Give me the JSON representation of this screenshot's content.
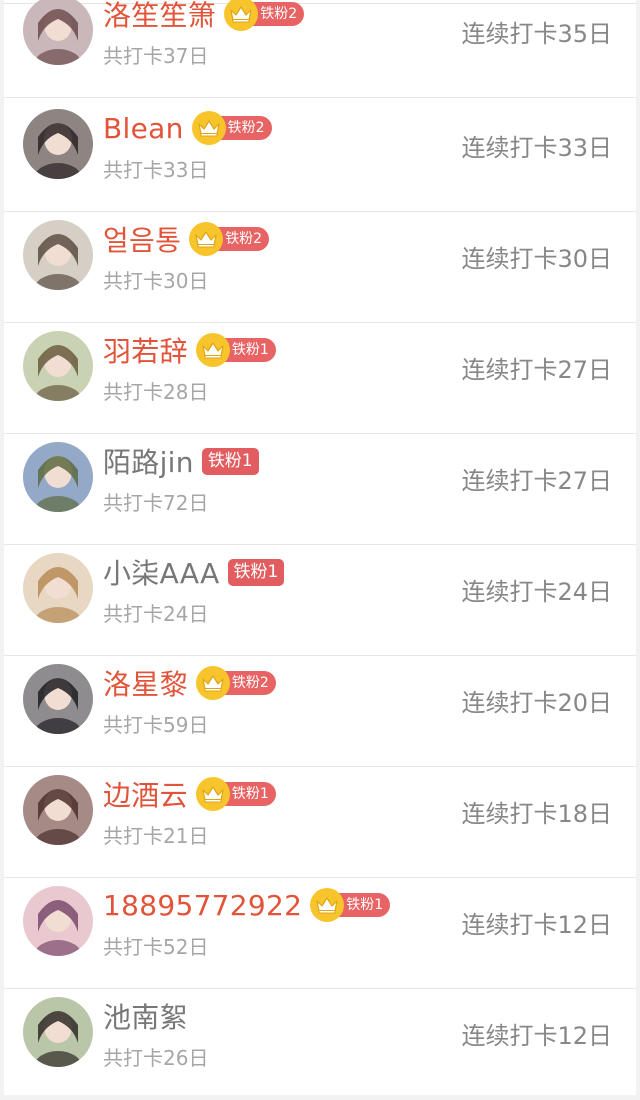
{
  "members": [
    {
      "name": "洛笙笙箫",
      "vip": true,
      "badge": "铁粉2",
      "crown": true,
      "total": "共打卡37日",
      "streak": "连续打卡35日",
      "avatar_color": "#c9b7b9",
      "avatar_accent": "#6b4a4c"
    },
    {
      "name": "Blean",
      "vip": true,
      "badge": "铁粉2",
      "crown": true,
      "total": "共打卡33日",
      "streak": "连续打卡33日",
      "avatar_color": "#8e8482",
      "avatar_accent": "#2b2424"
    },
    {
      "name": "얼음통",
      "vip": true,
      "badge": "铁粉2",
      "crown": true,
      "total": "共打卡30日",
      "streak": "连续打卡30日",
      "avatar_color": "#d6cfc5",
      "avatar_accent": "#5a4d42"
    },
    {
      "name": "羽若辞",
      "vip": true,
      "badge": "铁粉1",
      "crown": true,
      "total": "共打卡28日",
      "streak": "连续打卡27日",
      "avatar_color": "#c9d3b4",
      "avatar_accent": "#6a5a3e"
    },
    {
      "name": "陌路jin",
      "vip": false,
      "badge": "铁粉1",
      "crown": false,
      "total": "共打卡72日",
      "streak": "连续打卡27日",
      "avatar_color": "#93a9c7",
      "avatar_accent": "#5d6b3f"
    },
    {
      "name": "小柒AAA",
      "vip": false,
      "badge": "铁粉1",
      "crown": false,
      "total": "共打卡24日",
      "streak": "连续打卡24日",
      "avatar_color": "#e7d7c3",
      "avatar_accent": "#b78b55"
    },
    {
      "name": "洛星黎",
      "vip": true,
      "badge": "铁粉2",
      "crown": true,
      "total": "共打卡59日",
      "streak": "连续打卡20日",
      "avatar_color": "#8f8c8f",
      "avatar_accent": "#1f1d22"
    },
    {
      "name": "边酒云",
      "vip": true,
      "badge": "铁粉1",
      "crown": true,
      "total": "共打卡21日",
      "streak": "连续打卡18日",
      "avatar_color": "#a58a85",
      "avatar_accent": "#4b2f2d"
    },
    {
      "name": "18895772922",
      "vip": true,
      "badge": "铁粉1",
      "crown": true,
      "total": "共打卡52日",
      "streak": "连续打卡12日",
      "avatar_color": "#e9c9cf",
      "avatar_accent": "#7a4a6e"
    },
    {
      "name": "池南絮",
      "vip": false,
      "badge": "",
      "crown": false,
      "total": "共打卡26日",
      "streak": "连续打卡12日",
      "avatar_color": "#b9c7a8",
      "avatar_accent": "#2f2a27"
    }
  ],
  "colors": {
    "vip_name": "#e2543a",
    "plain_name": "#777777",
    "badge_red": "#e86464",
    "crown_gold": "#f7c52b"
  }
}
